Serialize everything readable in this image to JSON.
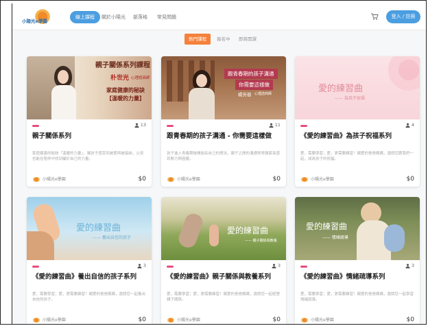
{
  "logo": {
    "text": "小陽光e學園"
  },
  "nav": {
    "items": [
      "線上課程",
      "關於小陽光",
      "部落格",
      "常見問題"
    ],
    "login_label": "登入 / 註冊"
  },
  "tabs": [
    "熱門課程",
    "報名中",
    "即將開課"
  ],
  "courses": [
    {
      "title": "親子關係系列",
      "learners": "13",
      "desc": "家庭健康的秘訣「溫暖的力量」，讓孩子感受到被愛與被接納，父母也能在陪伴中找到屬於自己的力量。",
      "author": "小陽光e學園",
      "price": "$0",
      "thumb": {
        "heading": "親子關係系列課程",
        "name": "朴世光",
        "role": "心理諮商師",
        "line1": "家庭健康的秘訣",
        "line2": "【溫暖的力量】"
      }
    },
    {
      "title": "跟青春期的孩子溝通 - 你需要這樣做",
      "learners": "11",
      "desc": "孩子進入青春期後開始有自己的想法，親子之間的溝通常常讓家長感到無力與困擾。",
      "author": "小陽光e學園",
      "price": "$0",
      "thumb": {
        "heading": "跟青春期的孩子溝通",
        "sub": "你需要這樣做",
        "name": "楊芳慈",
        "role": "心理諮商師"
      }
    },
    {
      "title": "《愛的練習曲》為孩子祝福系列",
      "learners": "4",
      "desc": "愛，需要學習；愛，更需要練習！親愛的爸爸媽媽，邀請您跟我們一起，成為孩子的祝福。",
      "author": "小陽光e學園",
      "price": "$0",
      "thumb": {
        "heading": "愛的練習曲",
        "sub": "為孩子祝福"
      }
    },
    {
      "title": "《愛的練習曲》養出自信的孩子系列",
      "learners": "3",
      "desc": "愛，需要學習；愛，更需要練習！親愛的爸爸媽媽，邀請您一起養出自信的孩子。",
      "author": "小陽光e學園",
      "price": "$0",
      "thumb": {
        "heading": "愛的練習曲",
        "sub": "養出自信的孩子"
      }
    },
    {
      "title": "《愛的練習曲》親子關係與教養系列",
      "learners": "3",
      "desc": "愛，需要學習；愛，更需要練習！親愛的爸爸媽媽，邀請您一起經營親子關係。",
      "author": "小陽光e學園",
      "price": "$0",
      "thumb": {
        "heading": "愛的練習曲",
        "sub": "親子關係與教養"
      }
    },
    {
      "title": "《愛的練習曲》情緒疏導系列",
      "learners": "3",
      "desc": "愛，需要學習；愛，更需要練習！親愛的爸爸媽媽，邀請您一起學習情緒疏導。",
      "author": "小陽光e學園",
      "price": "$0",
      "thumb": {
        "heading": "愛的練習曲",
        "sub": "情緒疏導"
      }
    }
  ],
  "colors": {
    "accent": "#4b9ee0",
    "tab_active": "#f5813a",
    "badge": "#e84c7b"
  }
}
